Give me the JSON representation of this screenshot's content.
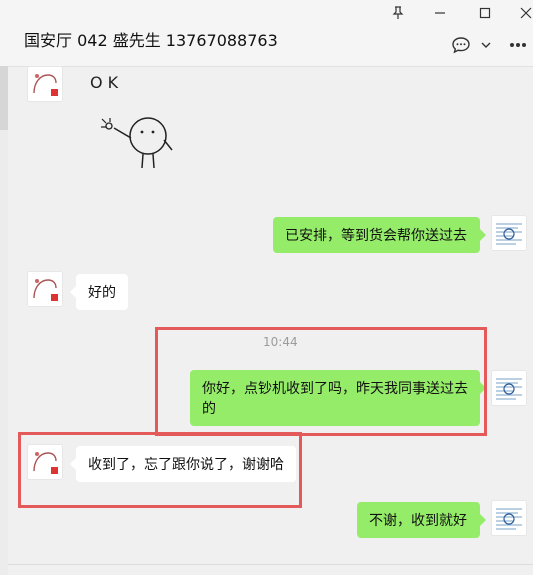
{
  "header": {
    "title": "国安厅 042 盛先生 13767088763",
    "icons": [
      "pin-icon",
      "minimize-icon",
      "maximize-icon",
      "close-icon",
      "chat-icon",
      "chevron-down-icon",
      "more-icon"
    ]
  },
  "messages": {
    "m1": "已安排，等到货会帮你送过去",
    "m2": "好的",
    "m3_time": "10:44",
    "m3_line1": "你好，点钞机收到了吗，昨天我同事送过去",
    "m3_line2": "的",
    "m4": "收到了，忘了跟你说了，谢谢哈",
    "m5": "不谢，收到就好"
  },
  "sticker": {
    "text": "O K"
  },
  "colors": {
    "bg": "#f0f0f0",
    "my_bubble": "#95ec69",
    "their_bubble": "#ffffff",
    "highlight": "#e45a5a"
  }
}
